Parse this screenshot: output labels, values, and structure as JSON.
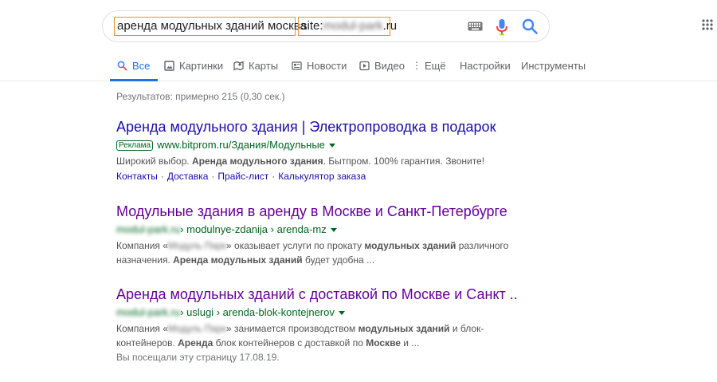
{
  "search": {
    "query_text": "аренда модульных зданий москва",
    "site_prefix": "site:",
    "site_domain": "modul-park",
    "site_tld": ".ru"
  },
  "tabs": [
    {
      "label": "Все",
      "icon": "search-icon",
      "active": true
    },
    {
      "label": "Картинки",
      "icon": "image-icon"
    },
    {
      "label": "Карты",
      "icon": "map-icon"
    },
    {
      "label": "Новости",
      "icon": "news-icon"
    },
    {
      "label": "Видео",
      "icon": "video-icon"
    },
    {
      "label": "Ещё",
      "icon": "more-icon"
    },
    {
      "label": "Настройки"
    },
    {
      "label": "Инструменты"
    }
  ],
  "stats": "Результатов: примерно 215 (0,30 сек.)",
  "results": [
    {
      "title": "Аренда модульного здания | Электропроводка в подарок",
      "ad_label": "Реклама",
      "url": "www.bitprom.ru/Здания/Модульные",
      "snippet": {
        "s1": "Широкий выбор. ",
        "b1": "Аренда модульного здания",
        "s2": ". Бытпром. 100% гарантия. Звоните!"
      },
      "sitelinks": [
        "Контакты",
        "Доставка",
        "Прайс-лист",
        "Калькулятор заказа"
      ]
    },
    {
      "title": "Модульные здания в аренду в Москве и Санкт-Петербурге",
      "url_domain": "modul-park.ru",
      "url_path": " › modulnye-zdanija › arenda-mz",
      "snippet": {
        "s1": "Компания «",
        "blur": "Модуль Парк",
        "s2": "» оказывает услуги по прокату ",
        "b1": "модульных зданий",
        "s3": " различного назначения. ",
        "b2": "Аренда модульных зданий",
        "s4": " будет удобна ..."
      }
    },
    {
      "title": "Аренда модульных зданий с доставкой по Москве и Санкт ..",
      "url_domain": "modul-park.ru",
      "url_path": " › uslugi › arenda-blok-kontejnerov",
      "snippet": {
        "s1": "Компания «",
        "blur": "Модуль Парк",
        "s2": "» занимается производством ",
        "b1": "модульных зданий",
        "s3": " и блок-контейнеров. ",
        "b2": "Аренда",
        "s4": " блок контейнеров с доставкой по ",
        "b3": "Москве",
        "s5": " и ..."
      },
      "visited": "Вы посещали эту страницу 17.08.19."
    }
  ],
  "colors": {
    "link": "#1a0dab",
    "visited": "#660099",
    "url_green": "#006621",
    "accent_blue": "#1a73e8",
    "highlight_orange": "#e8912d"
  }
}
